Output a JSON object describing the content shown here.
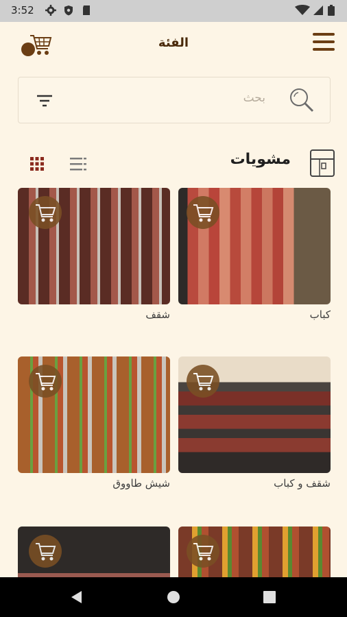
{
  "status_bar": {
    "time": "3:52"
  },
  "header": {
    "title": "الفئة"
  },
  "search": {
    "placeholder": "بحث"
  },
  "section": {
    "title": "مشويات"
  },
  "products": [
    {
      "name": "كباب"
    },
    {
      "name": "شقف"
    },
    {
      "name": "شقف و كباب"
    },
    {
      "name": "شيش طاووق"
    },
    {
      "name": ""
    },
    {
      "name": ""
    }
  ],
  "colors": {
    "background": "#fdf5e6",
    "brand": "#7a4f24",
    "grid_icon": "#8b2a1e"
  }
}
